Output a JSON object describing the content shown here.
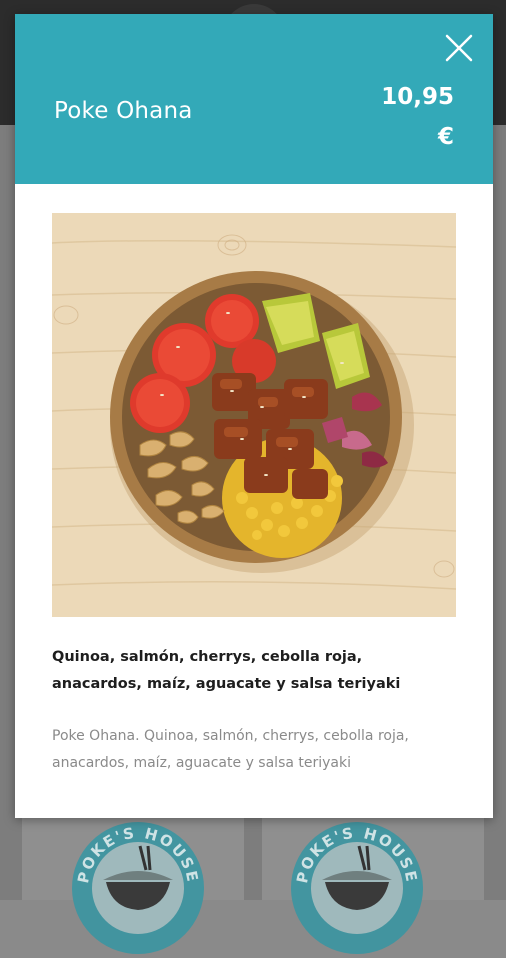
{
  "product": {
    "title": "Poke Ohana",
    "price_amount": "10,95",
    "price_currency": "€",
    "ingredients": "Quinoa, salmón, cherrys, cebolla roja, anacardos, maíz, aguacate y salsa teriyaki",
    "description": "Poke Ohana. Quinoa, salmón, cherrys, cebolla roja, anacardos, maíz, aguacate y salsa teriyaki"
  },
  "background": {
    "logo_text": "POKE'S HOUSE"
  },
  "icons": {
    "close": "close-icon",
    "logo": "bowl-chopsticks-icon"
  },
  "colors": {
    "accent": "#33a9b8",
    "overlay": "#7d7d7d",
    "ingredients_text": "#1e1e1e",
    "description_text": "#8a8a8a"
  }
}
